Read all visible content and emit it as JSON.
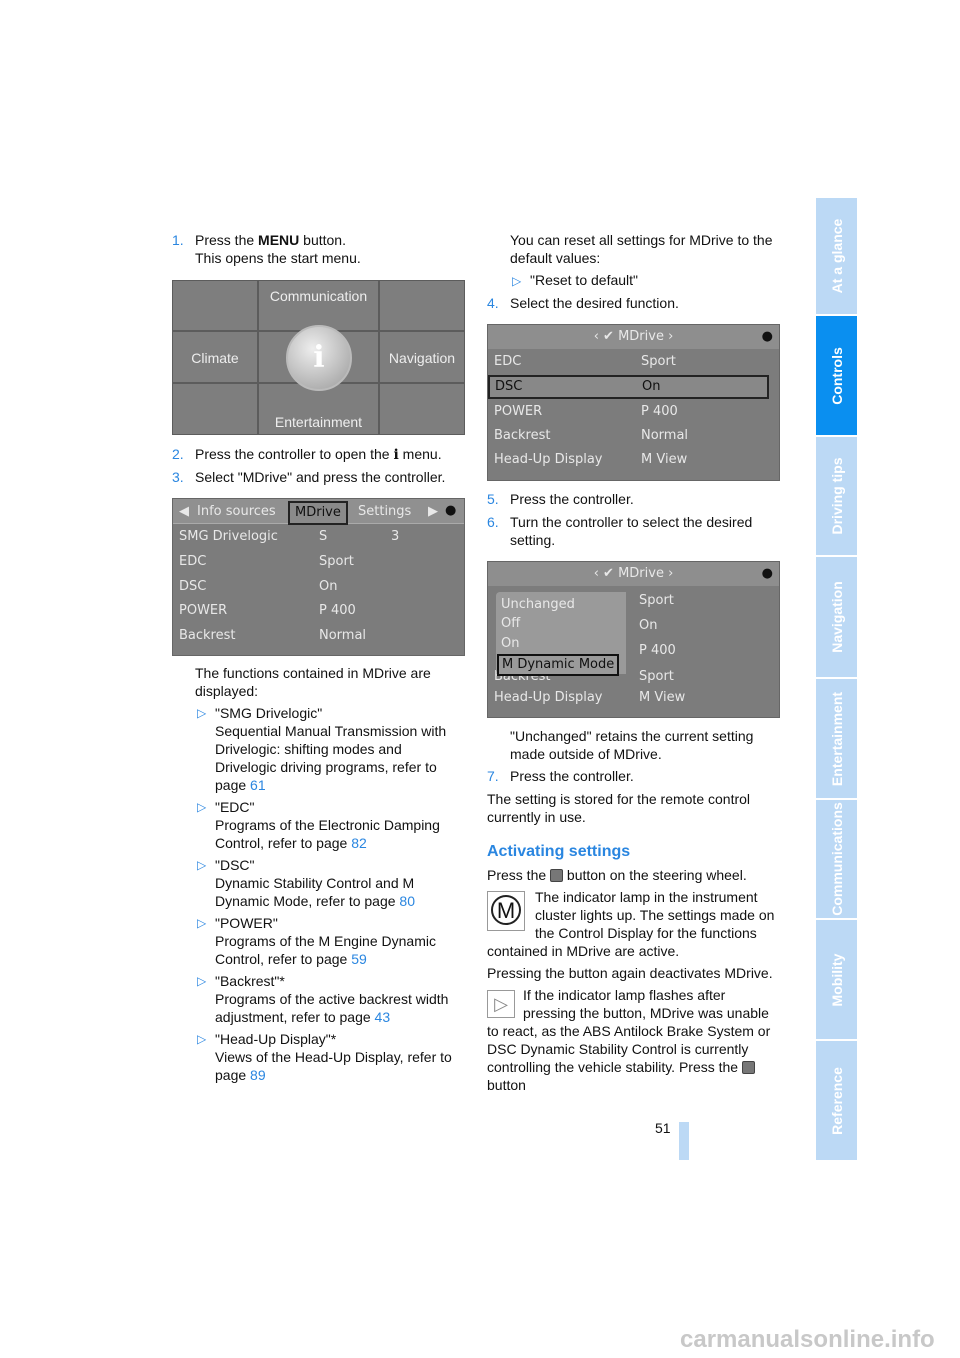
{
  "left": {
    "step1": {
      "num": "1.",
      "pre": "Press the ",
      "bold": "MENU",
      "post": " button.",
      "line2": "This opens the start menu."
    },
    "start_menu": {
      "top": "Communication",
      "left": "Climate",
      "right": "Navigation",
      "bottom": "Entertainment",
      "center": "i"
    },
    "step2": {
      "num": "2.",
      "pre": "Press the controller to open the ",
      "icon": "i",
      "post": " menu."
    },
    "step3": {
      "num": "3.",
      "text": "Select \"MDrive\" and press the controller."
    },
    "mdrive_screen": {
      "tabs": [
        "Info sources",
        "MDrive",
        "Settings"
      ],
      "rows": [
        [
          "SMG Drivelogic",
          "S",
          "3"
        ],
        [
          "EDC",
          "Sport"
        ],
        [
          "DSC",
          "On"
        ],
        [
          "POWER",
          "P 400"
        ],
        [
          "Backrest",
          "Normal"
        ]
      ]
    },
    "intro": "The functions contained in MDrive are displayed:",
    "bullet": "▷",
    "items": [
      {
        "title": "\"SMG Drivelogic\"",
        "desc": "Sequential Manual Transmission with Drivelogic: shifting modes and Drivelogic driving programs, refer to page ",
        "page": "61"
      },
      {
        "title": "\"EDC\"",
        "desc": "Programs of the Electronic Damping Control, refer to page ",
        "page": "82"
      },
      {
        "title": "\"DSC\"",
        "desc": "Dynamic Stability Control and M Dynamic Mode, refer to page ",
        "page": "80"
      },
      {
        "title": "\"POWER\"",
        "desc": "Programs of the M Engine Dynamic Control, refer to page ",
        "page": "59"
      },
      {
        "title": "\"Backrest\"*",
        "desc": "Programs of the active backrest width adjustment, refer to page ",
        "page": "43"
      },
      {
        "title": "\"Head-Up Display\"*",
        "desc": "Views of the Head-Up Display, refer to page ",
        "page": "89"
      }
    ]
  },
  "right": {
    "reset_text": "You can reset all settings for MDrive to the default values:",
    "reset_item": "\"Reset to default\"",
    "step4": {
      "num": "4.",
      "text": "Select the desired function."
    },
    "screen2": {
      "title": "MDrive",
      "rows": [
        [
          "EDC",
          "Sport"
        ],
        [
          "DSC",
          "On"
        ],
        [
          "POWER",
          "P 400"
        ],
        [
          "Backrest",
          "Normal"
        ],
        [
          "Head-Up Display",
          "M View"
        ]
      ]
    },
    "step5": {
      "num": "5.",
      "text": "Press the controller."
    },
    "step6": {
      "num": "6.",
      "text": "Turn the controller to select the desired setting."
    },
    "screen3": {
      "title": "MDrive",
      "options": [
        "Unchanged",
        "Off",
        "On",
        "M Dynamic Mode"
      ],
      "values": [
        "Sport",
        "On",
        "P 400",
        "Sport",
        "M View"
      ],
      "labels": [
        "Backrest",
        "Head-Up Display"
      ]
    },
    "unchanged_note": "\"Unchanged\" retains the current setting made outside of MDrive.",
    "step7": {
      "num": "7.",
      "text": "Press the controller."
    },
    "stored": "The setting is stored for the remote control currently in use.",
    "heading": "Activating settings",
    "press_pre": "Press the ",
    "press_post": " button on the steering wheel.",
    "m_icon": "M",
    "indicator": "The indicator lamp in the instrument cluster lights up. The settings made on the Control Display for the functions contained in MDrive are active.",
    "deactivate": "Pressing the button again deactivates MDrive.",
    "note": "If the indicator lamp flashes after pressing the button, MDrive was unable to react, as the ABS Antilock Brake System or DSC Dynamic Stability Control is currently controlling the vehicle stability. Press the ",
    "note_end": " button"
  },
  "page_number": "51",
  "side_tabs": [
    {
      "label": "At a glance"
    },
    {
      "label": "Controls",
      "active": true
    },
    {
      "label": "Driving tips"
    },
    {
      "label": "Navigation"
    },
    {
      "label": "Entertainment"
    },
    {
      "label": "Communications"
    },
    {
      "label": "Mobility"
    },
    {
      "label": "Reference"
    }
  ],
  "watermark": "carmanualsonline.info",
  "colors": {
    "accent": "#2a86e0",
    "tab": "#bcd9f5",
    "tab_active": "#0a8ff0"
  }
}
